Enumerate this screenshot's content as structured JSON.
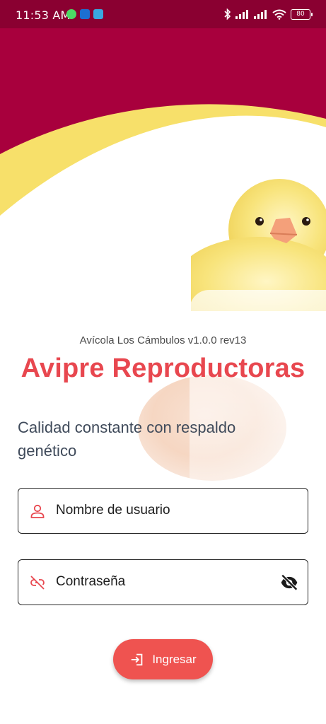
{
  "status_bar": {
    "time": "11:53 AM",
    "battery": "80"
  },
  "app": {
    "version": "Avícola Los Cámbulos v1.0.0 rev13",
    "title": "Avipre Reproductoras",
    "tagline": "Calidad constante con respaldo genético"
  },
  "form": {
    "username_placeholder": "Nombre de usuario",
    "username_value": "",
    "password_placeholder": "Contraseña",
    "password_value": "",
    "login_label": "Ingresar"
  },
  "icons": {
    "username": "person-icon",
    "password": "link-off-icon",
    "visibility": "eye-off-icon",
    "login": "login-arrow-icon"
  },
  "colors": {
    "header_primary": "#a8003d",
    "header_accent": "#f7e06a",
    "title": "#e8474f",
    "button": "#ef5350",
    "status_bar": "#8a0031"
  }
}
